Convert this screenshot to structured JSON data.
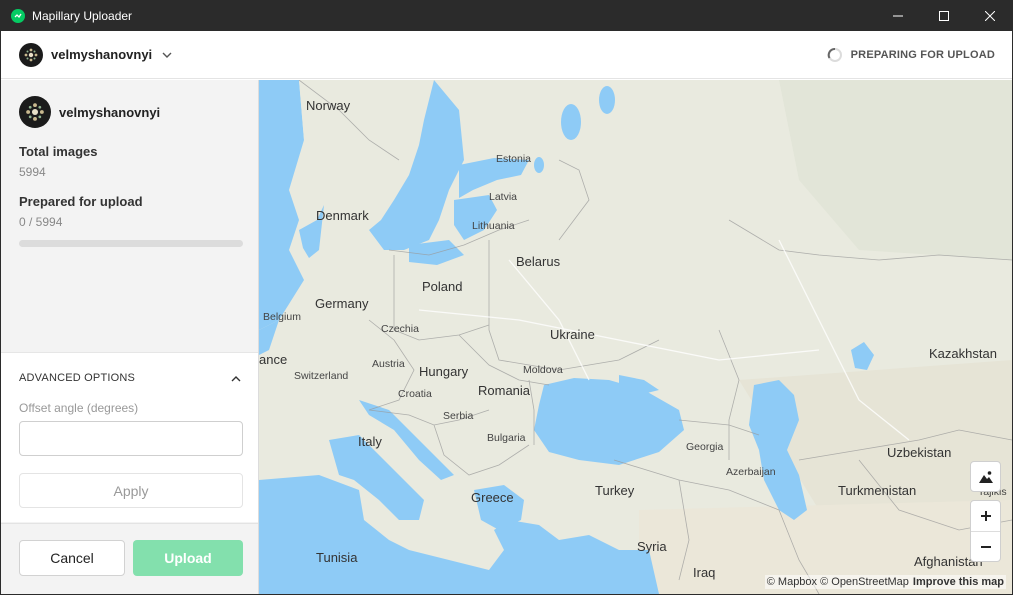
{
  "window": {
    "title": "Mapillary Uploader",
    "controls": [
      "minimize",
      "maximize",
      "close"
    ]
  },
  "header": {
    "username": "velmyshanovnyi",
    "status": "PREPARING FOR UPLOAD"
  },
  "sidebar": {
    "username": "velmyshanovnyi",
    "total_images_label": "Total images",
    "total_images_value": "5994",
    "prepared_label": "Prepared for upload",
    "prepared_value": "0 / 5994",
    "prepared_progress": 0
  },
  "advanced": {
    "title": "ADVANCED OPTIONS",
    "offset_label": "Offset angle (degrees)",
    "offset_value": "",
    "apply_label": "Apply"
  },
  "footer": {
    "cancel_label": "Cancel",
    "upload_label": "Upload"
  },
  "map": {
    "countries": [
      "Norway",
      "Estonia",
      "Latvia",
      "Lithuania",
      "Denmark",
      "Belarus",
      "Poland",
      "Germany",
      "Belgium",
      "Czechia",
      "Ukraine",
      "Kazakhstan",
      "Austria",
      "Moldova",
      "Hungary",
      "Switzerland",
      "Romania",
      "Croatia",
      "Serbia",
      "Italy",
      "Bulgaria",
      "Georgia",
      "Uzbekistan",
      "Azerbaijan",
      "Greece",
      "Turkey",
      "Turkmenistan",
      "Tajikis",
      "Syria",
      "Tunisia",
      "Afghanistan",
      "Iraq",
      "ance"
    ],
    "attribution": "© Mapbox © OpenStreetMap",
    "improve_link": "Improve this map"
  },
  "colors": {
    "accent": "#05cb63",
    "upload_disabled": "#83e0ad",
    "water": "#8ecbf6",
    "land": "#e9eadf",
    "titlebar": "#2b2b2b"
  }
}
